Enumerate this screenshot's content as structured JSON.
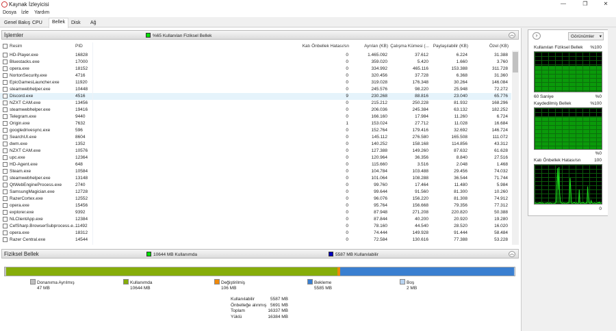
{
  "window": {
    "title": "Kaynak İzleyicisi",
    "min": "—",
    "max": "❐",
    "close": "✕"
  },
  "menu": [
    "Dosya",
    "İzle",
    "Yardım"
  ],
  "tabs": [
    "Genel Bakış",
    "CPU",
    "Bellek",
    "Disk",
    "Ağ"
  ],
  "processes": {
    "title": "İşlemler",
    "summary": "%65 Kullanılan Fiziksel Bellek",
    "summary_color": "#00e000",
    "columns": [
      "Resim",
      "PID",
      "Katı Önbellek Hatası/sn",
      "Ayrılan (KB)",
      "Çalışma Kümesi (...",
      "Paylaşılabilir (KB)",
      "Özel (KB)"
    ],
    "rows": [
      [
        "HD-Player.exe",
        "16828",
        "0",
        "1.465.092",
        "37.612",
        "6.224",
        "31.388"
      ],
      [
        "Bluestacks.exe",
        "17000",
        "0",
        "359.020",
        "5.420",
        "1.660",
        "3.760"
      ],
      [
        "opera.exe",
        "18152",
        "0",
        "334.992",
        "465.116",
        "153.388",
        "311.728"
      ],
      [
        "NortonSecurity.exe",
        "4716",
        "0",
        "320.456",
        "37.728",
        "6.368",
        "31.360"
      ],
      [
        "EpicGamesLauncher.exe",
        "11920",
        "0",
        "319.028",
        "176.348",
        "30.264",
        "146.084"
      ],
      [
        "steamwebhelper.exe",
        "10448",
        "0",
        "245.576",
        "98.220",
        "25.948",
        "72.272"
      ],
      [
        "Discord.exe",
        "4516",
        "9",
        "230.268",
        "88.816",
        "23.040",
        "65.776"
      ],
      [
        "NZXT CAM.exe",
        "13456",
        "0",
        "215.212",
        "250.228",
        "81.932",
        "168.296"
      ],
      [
        "steamwebhelper.exe",
        "19416",
        "0",
        "206.036",
        "245.384",
        "63.132",
        "182.252"
      ],
      [
        "Telegram.exe",
        "9440",
        "0",
        "166.160",
        "17.984",
        "11.260",
        "6.724"
      ],
      [
        "Origin.exe",
        "7632",
        "1",
        "153.024",
        "27.712",
        "11.028",
        "16.684"
      ],
      [
        "googledrivesync.exe",
        "596",
        "0",
        "152.764",
        "179.416",
        "32.692",
        "146.724"
      ],
      [
        "SearchUI.exe",
        "8604",
        "0",
        "145.112",
        "276.580",
        "165.508",
        "111.072"
      ],
      [
        "dwm.exe",
        "1352",
        "0",
        "140.252",
        "158.168",
        "114.856",
        "43.312"
      ],
      [
        "NZXT CAM.exe",
        "10576",
        "0",
        "127.388",
        "149.260",
        "87.632",
        "61.628"
      ],
      [
        "upc.exe",
        "12364",
        "0",
        "120.964",
        "36.356",
        "8.840",
        "27.516"
      ],
      [
        "HD-Agent.exe",
        "648",
        "0",
        "115.660",
        "3.516",
        "2.048",
        "1.468"
      ],
      [
        "Steam.exe",
        "10584",
        "0",
        "104.784",
        "103.488",
        "29.456",
        "74.032"
      ],
      [
        "steamwebhelper.exe",
        "13148",
        "0",
        "101.064",
        "108.288",
        "36.544",
        "71.744"
      ],
      [
        "QtWebEngineProcess.exe",
        "2740",
        "0",
        "99.760",
        "17.464",
        "11.480",
        "5.984"
      ],
      [
        "SamsungMagician.exe",
        "12728",
        "0",
        "99.644",
        "91.560",
        "81.300",
        "10.260"
      ],
      [
        "RazerCortex.exe",
        "12552",
        "0",
        "96.076",
        "156.220",
        "81.308",
        "74.912"
      ],
      [
        "opera.exe",
        "15456",
        "0",
        "95.764",
        "156.668",
        "79.356",
        "77.312"
      ],
      [
        "explorer.exe",
        "9392",
        "0",
        "87.948",
        "271.208",
        "220.820",
        "50.388"
      ],
      [
        "NLClientApp.exe",
        "12384",
        "0",
        "87.844",
        "40.200",
        "20.920",
        "19.280"
      ],
      [
        "CefSharp.BrowserSubprocess.e...",
        "11492",
        "0",
        "78.160",
        "44.540",
        "28.520",
        "16.020"
      ],
      [
        "opera.exe",
        "18312",
        "0",
        "74.444",
        "149.928",
        "91.444",
        "58.484"
      ],
      [
        "Razer Central.exe",
        "14544",
        "0",
        "72.584",
        "130.616",
        "77.388",
        "53.228"
      ]
    ],
    "selected_index": 6
  },
  "physical": {
    "title": "Fiziksel Bellek",
    "summary1": "10644 MB Kullanımda",
    "summary1_color": "#00e000",
    "summary2": "5587 MB Kullanılabilir",
    "summary2_color": "#0000c0",
    "segments": [
      {
        "label": "Donanıma Ayrılmış",
        "value": "47 MB",
        "mb": 47,
        "color": "#c0c0c0"
      },
      {
        "label": "Kullanımda",
        "value": "10644 MB",
        "mb": 10644,
        "color": "#86ad0a"
      },
      {
        "label": "Değiştirilmiş",
        "value": "106 MB",
        "mb": 106,
        "color": "#f0890a"
      },
      {
        "label": "Bekleme",
        "value": "5585 MB",
        "mb": 5585,
        "color": "#3a7fd0"
      },
      {
        "label": "Boş",
        "value": "2 MB",
        "mb": 2,
        "color": "#b9d3ef"
      }
    ],
    "stats": [
      {
        "label": "Kullanılabilir",
        "value": "5587 MB"
      },
      {
        "label": "Önbelleğe alınmış",
        "value": "5691 MB"
      },
      {
        "label": "Toplam",
        "value": "16337 MB"
      },
      {
        "label": "Yüklü",
        "value": "16384 MB"
      }
    ]
  },
  "side": {
    "views_label": "Görünümler",
    "graphs": [
      {
        "title": "Kullanılan Fiziksel Bellek",
        "max": "%100",
        "min": "%0",
        "footer": "60 Saniye",
        "level": 0.65
      },
      {
        "title": "Kaydedilmiş Bellek",
        "max": "%100",
        "min": "%0",
        "level": 0.78
      },
      {
        "title": "Katı Önbellek Hatası/sn",
        "max": "100",
        "min": "0",
        "spikes": [
          4,
          6,
          5,
          4,
          5,
          3,
          6,
          5,
          7,
          4,
          5,
          6,
          4,
          5,
          3,
          4,
          5,
          4,
          6,
          5,
          5,
          4,
          6,
          5,
          4,
          5,
          3,
          4,
          5,
          4,
          6,
          8,
          60,
          95,
          40,
          98,
          30,
          10,
          6,
          5,
          4,
          5,
          6,
          4,
          5,
          5,
          4,
          6,
          5,
          6,
          30,
          70,
          35,
          5,
          4,
          5,
          6,
          7,
          5,
          4,
          6,
          5,
          4,
          5,
          40,
          5,
          4,
          6,
          5,
          6,
          7,
          4,
          5,
          4,
          6,
          5,
          48,
          20,
          6,
          5,
          4,
          12,
          6,
          5,
          4,
          5,
          6,
          4,
          5,
          4,
          5,
          7,
          5,
          8,
          4,
          5,
          6,
          5,
          4
        ]
      }
    ]
  }
}
